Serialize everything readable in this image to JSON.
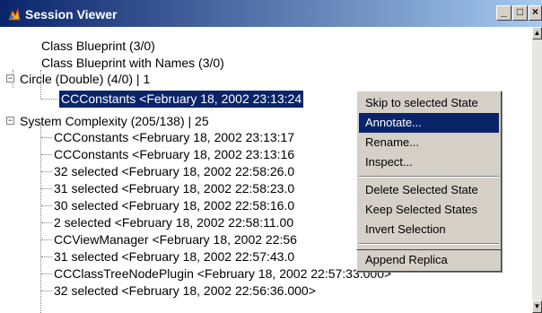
{
  "window": {
    "title": "Session Viewer",
    "minimize_icon": "minimize-icon",
    "maximize_icon": "maximize-icon",
    "close_icon": "close-icon"
  },
  "tree": {
    "rows": [
      {
        "label": "Class Blueprint (3/0)"
      },
      {
        "label": "Class Blueprint with Names (3/0)"
      },
      {
        "label": "Circle (Double) (4/0) | 1",
        "expander": "⊟"
      },
      {
        "label": "CCConstants  <February 18, 2002 23:13:24",
        "selected": true
      },
      {
        "label": "System Complexity (205/138) | 25",
        "expander": "⊟"
      },
      {
        "label": "CCConstants  <February 18, 2002 23:13:17"
      },
      {
        "label": "CCConstants  <February 18, 2002 23:13:16"
      },
      {
        "label": "32 selected  <February 18, 2002 22:58:26.0"
      },
      {
        "label": "31 selected  <February 18, 2002 22:58:23.0"
      },
      {
        "label": "30 selected  <February 18, 2002 22:58:16.0"
      },
      {
        "label": "2 selected  <February 18, 2002 22:58:11.00"
      },
      {
        "label": "CCViewManager  <February 18, 2002 22:56"
      },
      {
        "label": "31 selected  <February 18, 2002 22:57:43.0"
      },
      {
        "label": "CCClassTreeNodePlugin  <February 18, 2002 22:57:33.000>"
      },
      {
        "label": "32 selected  <February 18, 2002 22:56:36.000>"
      }
    ]
  },
  "context_menu": {
    "items": [
      {
        "label": "Skip to selected State"
      },
      {
        "label": "Annotate...",
        "highlighted": true
      },
      {
        "label": "Rename..."
      },
      {
        "label": "Inspect..."
      },
      {
        "label": "Delete Selected State"
      },
      {
        "label": "Keep Selected States"
      },
      {
        "label": "Invert Selection"
      },
      {
        "label": "Append Replica"
      }
    ]
  },
  "colors": {
    "titlebar": "#0a246a",
    "selection": "#0a246a",
    "menu_bg": "#d4d0c8"
  }
}
